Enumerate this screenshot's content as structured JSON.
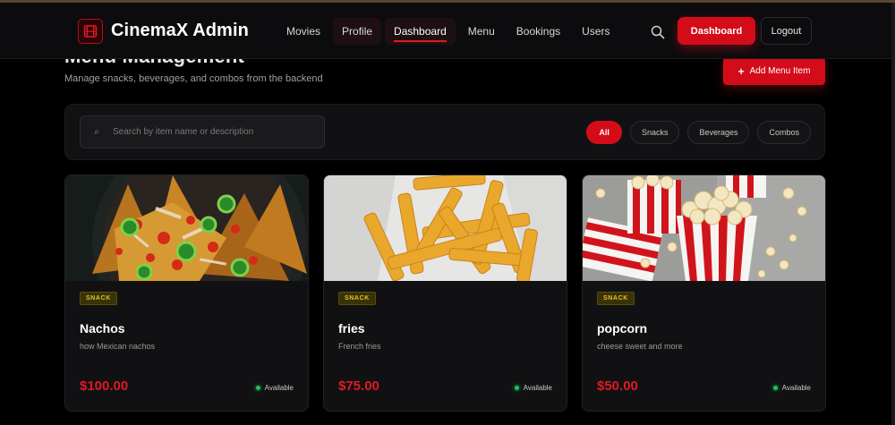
{
  "header": {
    "brand": "CinemaX Admin",
    "nav": [
      "Movies",
      "Profile",
      "Dashboard",
      "Menu",
      "Bookings",
      "Users"
    ],
    "dashboard_button": "Dashboard",
    "logout_button": "Logout"
  },
  "page": {
    "title": "Menu Management",
    "subtitle": "Manage snacks, beverages, and combos from the backend",
    "add_button": "Add Menu Item"
  },
  "filters": {
    "search_placeholder": "Search by item name or description",
    "chips": [
      "All",
      "Snacks",
      "Beverages",
      "Combos"
    ],
    "active": "All"
  },
  "items": [
    {
      "category": "SNACK",
      "name": "Nachos",
      "description": "how Mexican nachos",
      "price": "$100.00",
      "status": "Available",
      "image": "nachos"
    },
    {
      "category": "SNACK",
      "name": "fries",
      "description": "French fries",
      "price": "$75.00",
      "status": "Available",
      "image": "fries"
    },
    {
      "category": "SNACK",
      "name": "popcorn",
      "description": "cheese sweet and more",
      "price": "$50.00",
      "status": "Available",
      "image": "popcorn"
    }
  ],
  "colors": {
    "accent": "#d40c1a",
    "price": "#e01a22",
    "available": "#1fc15b",
    "badge_text": "#e2c22a"
  }
}
